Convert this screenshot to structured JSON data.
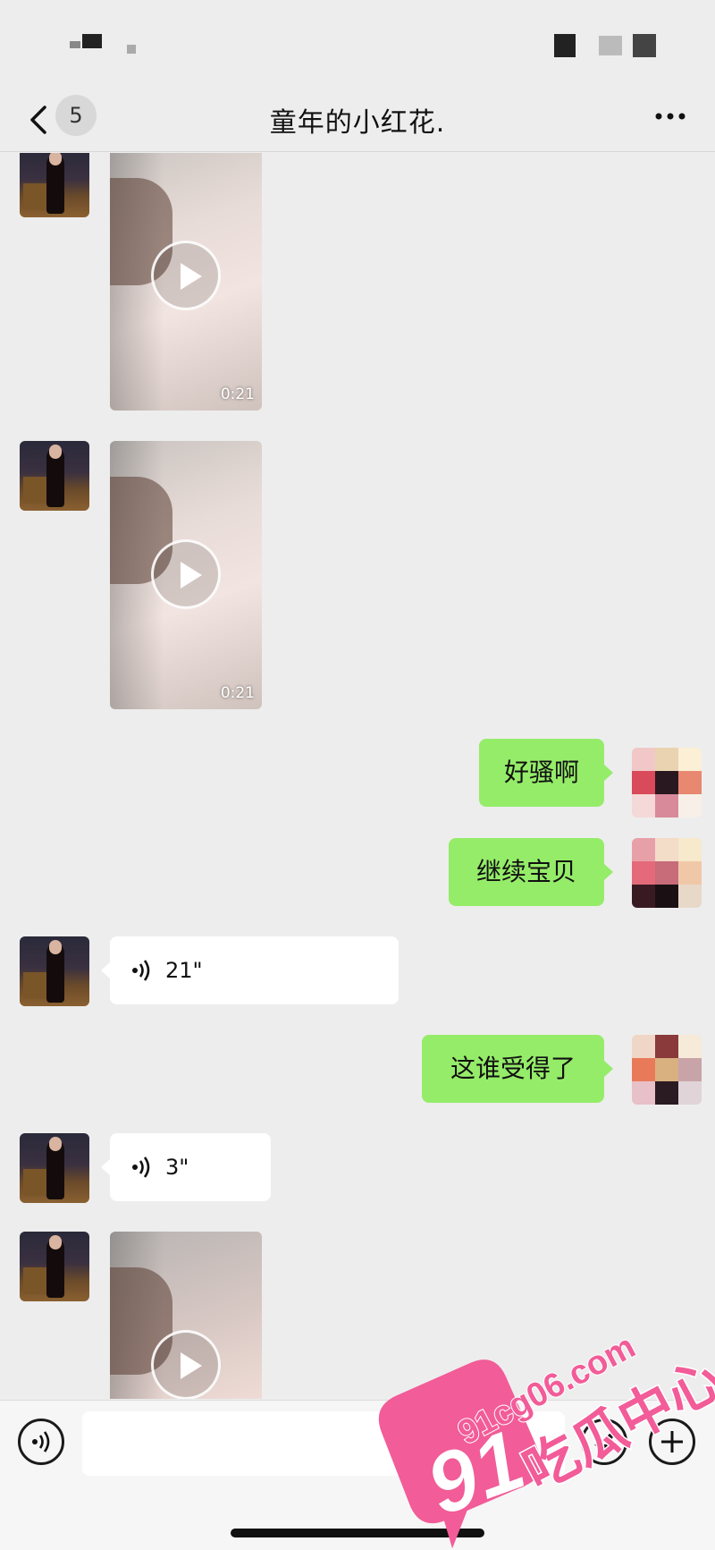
{
  "header": {
    "unread_count": "5",
    "title": "童年的小红花."
  },
  "messages": {
    "video1": {
      "duration": "0:21"
    },
    "video2": {
      "duration": "0:21"
    },
    "text1": "好骚啊",
    "text2": "继续宝贝",
    "voice1": {
      "length": "21\""
    },
    "text3": "这谁受得了",
    "voice2": {
      "length": "3\""
    }
  },
  "input": {
    "value": ""
  },
  "watermark": {
    "number": "91",
    "domain": "91cg06.com",
    "name": "吃瓜中心"
  },
  "colors": {
    "self_bubble": "#95ec69",
    "background": "#ededed",
    "watermark": "#f25c98"
  }
}
